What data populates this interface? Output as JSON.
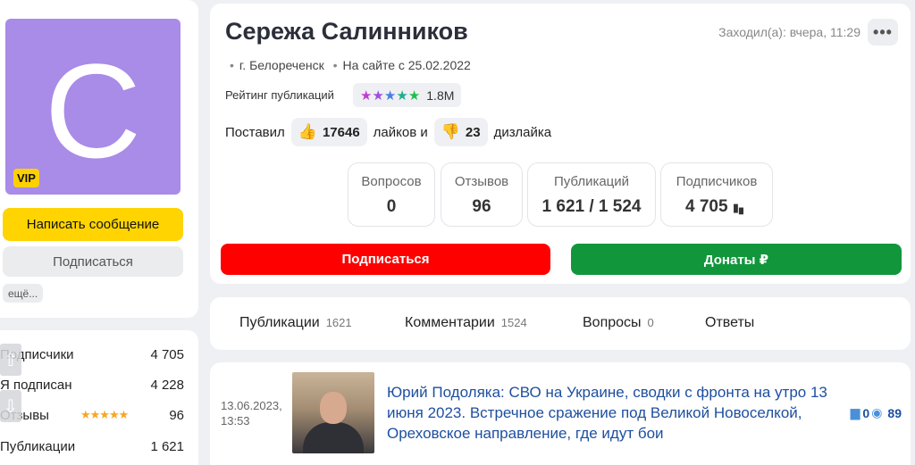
{
  "profile": {
    "name": "Сережа Салинников",
    "avatar_letter": "C",
    "vip": "VIP",
    "last_seen": "Заходил(а): вчера, 11:29",
    "city": "г. Белореченск",
    "since": "На сайте с 25.02.2022",
    "rating_label": "Рейтинг публикаций",
    "rating_value": "1.8M",
    "likes_prefix": "Поставил",
    "likes_count": "17646",
    "likes_mid": "лайков и",
    "dislikes_count": "23",
    "dislikes_suffix": "дизлайка"
  },
  "left_buttons": {
    "message": "Написать сообщение",
    "subscribe": "Подписаться",
    "more": "ещё..."
  },
  "left_stats": [
    {
      "label": "Подписчики",
      "value": "4 705"
    },
    {
      "label": "Я подписан",
      "value": "4 228"
    },
    {
      "label": "Отзывы",
      "value": "96",
      "stars": "★★★★★"
    },
    {
      "label": "Публикации",
      "value": "1 621"
    }
  ],
  "counters": {
    "questions": {
      "label": "Вопросов",
      "value": "0"
    },
    "reviews": {
      "label": "Отзывов",
      "value": "96"
    },
    "publications": {
      "label": "Публикаций",
      "value": "1 621 / 1 524"
    },
    "subscribers": {
      "label": "Подписчиков",
      "value": "4 705"
    }
  },
  "actions": {
    "subscribe": "Подписаться",
    "donate": "Донаты ₽"
  },
  "tabs": [
    {
      "label": "Публикации",
      "count": "1621"
    },
    {
      "label": "Комментарии",
      "count": "1524"
    },
    {
      "label": "Вопросы",
      "count": "0"
    },
    {
      "label": "Ответы",
      "count": ""
    }
  ],
  "publication": {
    "date": "13.06.2023,",
    "time": "13:53",
    "title": "Юрий Подоляка: СВО на Украине, сводки с фронта на утро 13 июня 2023. Встречное сражение под Великой Новоселкой, Ореховское направление, где идут бои",
    "comments": "0",
    "views": "89"
  },
  "icons": {
    "more": "more-dots-icon",
    "like": "thumbs-up-icon",
    "dislike": "thumbs-down-icon",
    "comments": "comment-icon",
    "views": "eye-icon",
    "scroll_up": "scroll-up-icon",
    "scroll_down": "scroll-down-icon"
  },
  "colors": {
    "avatar_bg": "#a98be8",
    "message_button": "#ffd400",
    "subscribe_button": "#ff0000",
    "donate_button": "#12963c",
    "link": "#1e4fa0"
  }
}
